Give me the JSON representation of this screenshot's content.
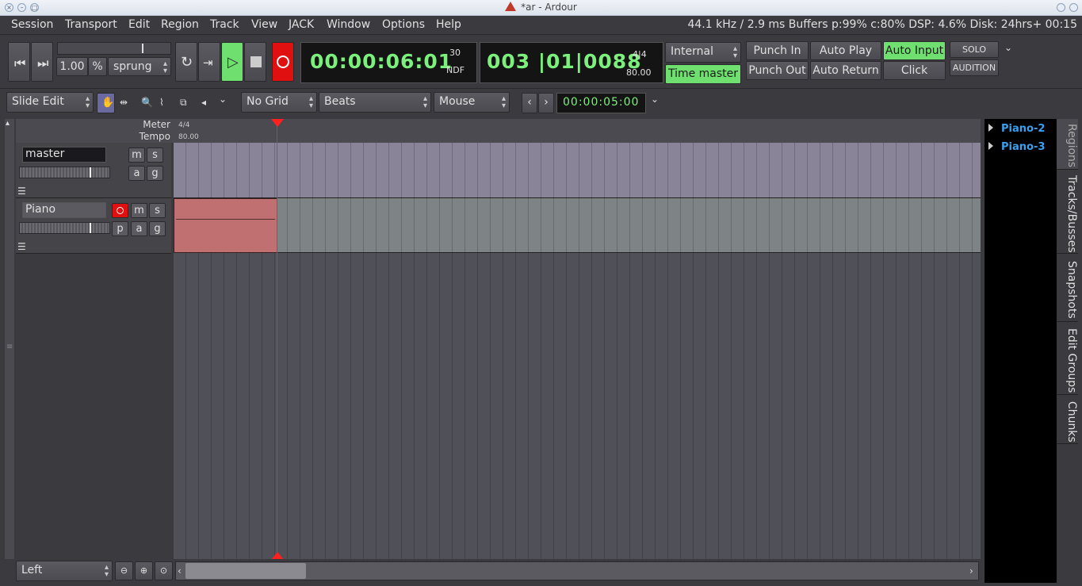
{
  "window": {
    "title": "*ar - Ardour"
  },
  "menu": [
    "Session",
    "Transport",
    "Edit",
    "Region",
    "Track",
    "View",
    "JACK",
    "Window",
    "Options",
    "Help"
  ],
  "status": "44.1 kHz /  2.9 ms  Buffers p:99% c:80%  DSP:   4.6%  Disk: 24hrs+  00:15",
  "transport": {
    "speed": "1.00",
    "percent": "%",
    "shuttle_mode": "sprung",
    "timecode": "00:00:06:01",
    "timecode_fps": "30",
    "timecode_ndf": "NDF",
    "bbt": "003 |01|0088",
    "meter": "4|4",
    "tempo": "80.00",
    "sync_source": "Internal",
    "time_master": "Time master",
    "punch_in": "Punch In",
    "punch_out": "Punch Out",
    "auto_play": "Auto Play",
    "auto_return": "Auto Return",
    "auto_input": "Auto Input",
    "click": "Click",
    "solo": "SOLO",
    "audition": "AUDITION"
  },
  "edit_toolbar": {
    "edit_mode": "Slide Edit",
    "grid": "No Grid",
    "grid_units": "Beats",
    "edit_point": "Mouse",
    "nudge_clock": "00:00:05:00"
  },
  "rulers": {
    "meter_label": "Meter",
    "tempo_label": "Tempo",
    "meter_value": "4/4",
    "tempo_value": "80.00"
  },
  "tracks": [
    {
      "name": "master",
      "buttons": [
        "m",
        "s",
        "a",
        "g"
      ]
    },
    {
      "name": "Piano",
      "buttons": [
        "m",
        "s",
        "p",
        "a",
        "g"
      ]
    }
  ],
  "zoom_focus": "Left",
  "regions": [
    "Piano-2",
    "Piano-3"
  ],
  "sidebar_tabs": [
    "Regions",
    "Tracks/Busses",
    "Snapshots",
    "Edit Groups",
    "Chunks"
  ],
  "colors": {
    "clock_green": "#7cf07c",
    "record_red": "#e01010",
    "region": "#c07070",
    "playhead": "#ff2020",
    "region_list_text": "#3aa0f0"
  }
}
